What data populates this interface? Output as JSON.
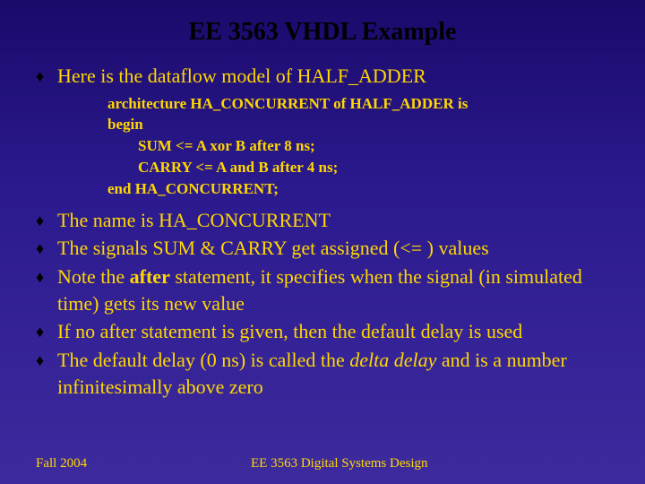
{
  "title": "EE 3563 VHDL Example",
  "bullets": {
    "b0": "Here is the dataflow model of HALF_ADDER",
    "b1": "The name is HA_CONCURRENT",
    "b2": "The signals SUM & CARRY get assigned (<= ) values",
    "b3_a": "Note the ",
    "b3_bold": "after",
    "b3_b": " statement, it specifies when the signal (in simulated time) gets its new value",
    "b4": "If no after statement is given, then the default delay is used",
    "b5_a": "The default delay (0 ns) is called the ",
    "b5_italic": "delta delay",
    "b5_b": " and is a number infinitesimally above zero"
  },
  "code": {
    "l0": "architecture HA_CONCURRENT of HALF_ADDER is",
    "l1": "begin",
    "l2": "SUM <= A xor B after 8 ns;",
    "l3": "CARRY <= A and B after 4 ns;",
    "l4": "end HA_CONCURRENT;"
  },
  "footer": {
    "left": "Fall 2004",
    "center": "EE 3563 Digital Systems Design"
  },
  "glyph": {
    "bullet": "♦"
  }
}
